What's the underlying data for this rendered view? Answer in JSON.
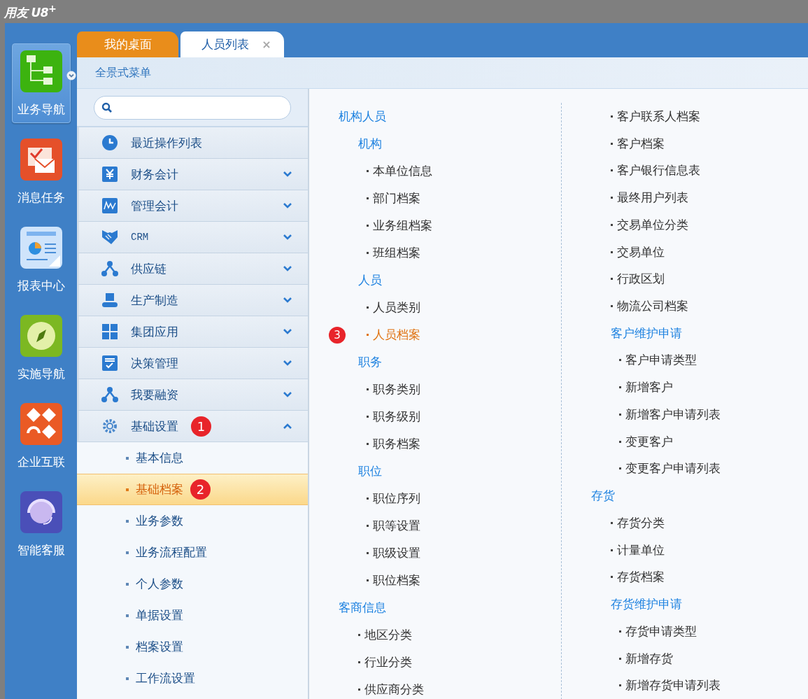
{
  "app": {
    "logo": "用友 U8$^{+}$"
  },
  "nav": [
    {
      "label": "业务导航",
      "selected": true
    },
    {
      "label": "消息任务",
      "selected": false
    },
    {
      "label": "报表中心",
      "selected": false
    },
    {
      "label": "实施导航",
      "selected": false
    },
    {
      "label": "企业互联",
      "selected": false
    },
    {
      "label": "智能客服",
      "selected": false
    }
  ],
  "tabs": [
    {
      "label": "我的桌面",
      "selected": false,
      "kind": "home"
    },
    {
      "label": "人员列表",
      "selected": true,
      "kind": "page",
      "close": "×"
    }
  ],
  "panel_title": "全景式菜单",
  "menu": [
    {
      "label": "最近操作列表",
      "kind": "list"
    },
    {
      "label": "财务会计",
      "kind": "module",
      "expanded": false
    },
    {
      "label": "管理会计",
      "kind": "module",
      "expanded": false
    },
    {
      "label": "CRM",
      "kind": "module",
      "expanded": false
    },
    {
      "label": "供应链",
      "kind": "module",
      "expanded": false
    },
    {
      "label": "生产制造",
      "kind": "module",
      "expanded": false
    },
    {
      "label": "集团应用",
      "kind": "module",
      "expanded": false
    },
    {
      "label": "决策管理",
      "kind": "module",
      "expanded": false
    },
    {
      "label": "我要融资",
      "kind": "module",
      "expanded": false
    },
    {
      "label": "基础设置",
      "kind": "module",
      "expanded": true,
      "badge": "1",
      "children": [
        {
          "label": "基本信息",
          "selected": false
        },
        {
          "label": "基础档案",
          "selected": true,
          "badge": "2"
        },
        {
          "label": "业务参数",
          "selected": false
        },
        {
          "label": "业务流程配置",
          "selected": false
        },
        {
          "label": "个人参数",
          "selected": false
        },
        {
          "label": "单据设置",
          "selected": false
        },
        {
          "label": "档案设置",
          "selected": false
        },
        {
          "label": "工作流设置",
          "selected": false
        }
      ]
    }
  ],
  "columns": [
    {
      "entries": [
        {
          "kind": "group",
          "label": "机构人员",
          "children": [
            {
              "kind": "subgroup",
              "label": "机构",
              "children": [
                {
                  "kind": "item",
                  "label": "本单位信息",
                  "selected": false
                },
                {
                  "kind": "item",
                  "label": "部门档案",
                  "selected": false
                },
                {
                  "kind": "item",
                  "label": "业务组档案",
                  "selected": false
                },
                {
                  "kind": "item",
                  "label": "班组档案",
                  "selected": false
                }
              ]
            },
            {
              "kind": "subgroup",
              "label": "人员",
              "children": [
                {
                  "kind": "item",
                  "label": "人员类别",
                  "selected": false
                },
                {
                  "kind": "item",
                  "label": "人员档案",
                  "selected": true,
                  "badge": "3"
                }
              ]
            },
            {
              "kind": "subgroup",
              "label": "职务",
              "children": [
                {
                  "kind": "item",
                  "label": "职务类别",
                  "selected": false
                },
                {
                  "kind": "item",
                  "label": "职务级别",
                  "selected": false
                },
                {
                  "kind": "item",
                  "label": "职务档案",
                  "selected": false
                }
              ]
            },
            {
              "kind": "subgroup",
              "label": "职位",
              "children": [
                {
                  "kind": "item",
                  "label": "职位序列",
                  "selected": false
                },
                {
                  "kind": "item",
                  "label": "职等设置",
                  "selected": false
                },
                {
                  "kind": "item",
                  "label": "职级设置",
                  "selected": false
                },
                {
                  "kind": "item",
                  "label": "职位档案",
                  "selected": false
                }
              ]
            }
          ]
        },
        {
          "kind": "group",
          "label": "客商信息",
          "children": [
            {
              "kind": "item",
              "label": "地区分类",
              "selected": false
            },
            {
              "kind": "item",
              "label": "行业分类",
              "selected": false
            },
            {
              "kind": "item",
              "label": "供应商分类",
              "selected": false
            }
          ]
        }
      ]
    },
    {
      "entries": [
        {
          "kind": "item",
          "label": "客户联系人档案",
          "selected": false
        },
        {
          "kind": "item",
          "label": "客户档案",
          "selected": false
        },
        {
          "kind": "item",
          "label": "客户银行信息表",
          "selected": false
        },
        {
          "kind": "item",
          "label": "最终用户列表",
          "selected": false
        },
        {
          "kind": "item",
          "label": "交易单位分类",
          "selected": false
        },
        {
          "kind": "item",
          "label": "交易单位",
          "selected": false
        },
        {
          "kind": "item",
          "label": "行政区划",
          "selected": false
        },
        {
          "kind": "item",
          "label": "物流公司档案",
          "selected": false
        },
        {
          "kind": "subgroup",
          "label": "客户维护申请",
          "children": [
            {
              "kind": "item",
              "label": "客户申请类型",
              "selected": false
            },
            {
              "kind": "item",
              "label": "新增客户",
              "selected": false
            },
            {
              "kind": "item",
              "label": "新增客户申请列表",
              "selected": false
            },
            {
              "kind": "item",
              "label": "变更客户",
              "selected": false
            },
            {
              "kind": "item",
              "label": "变更客户申请列表",
              "selected": false
            }
          ]
        },
        {
          "kind": "group",
          "label": "存货",
          "children": [
            {
              "kind": "item",
              "label": "存货分类",
              "selected": false
            },
            {
              "kind": "item",
              "label": "计量单位",
              "selected": false
            },
            {
              "kind": "item",
              "label": "存货档案",
              "selected": false
            },
            {
              "kind": "subgroup",
              "label": "存货维护申请",
              "children": [
                {
                  "kind": "item",
                  "label": "存货申请类型",
                  "selected": false
                },
                {
                  "kind": "item",
                  "label": "新增存货",
                  "selected": false
                },
                {
                  "kind": "item",
                  "label": "新增存货申请列表",
                  "selected": false
                }
              ]
            }
          ]
        }
      ]
    }
  ]
}
